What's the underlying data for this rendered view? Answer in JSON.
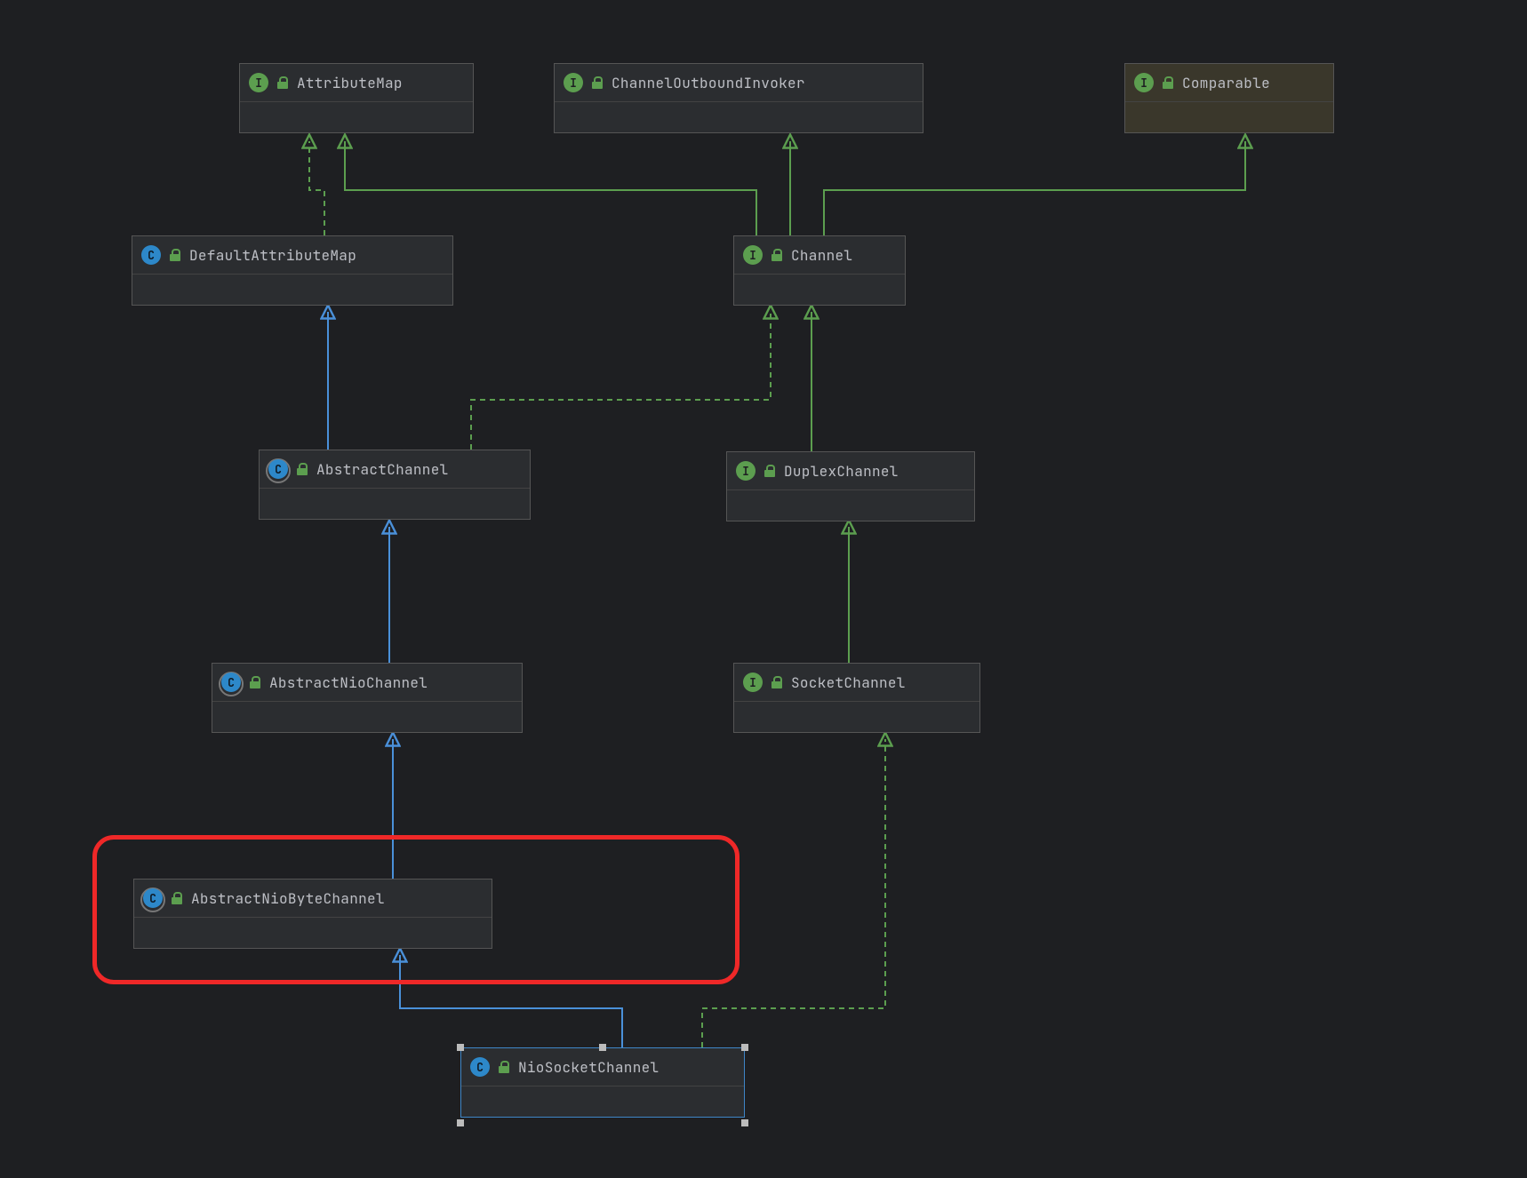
{
  "nodes": {
    "attributeMap": {
      "kind": "interface",
      "name": "AttributeMap"
    },
    "channelOutboundInvoker": {
      "kind": "interface",
      "name": "ChannelOutboundInvoker"
    },
    "comparable": {
      "kind": "interface",
      "name": "Comparable"
    },
    "defaultAttributeMap": {
      "kind": "class",
      "name": "DefaultAttributeMap"
    },
    "channel": {
      "kind": "interface",
      "name": "Channel"
    },
    "abstractChannel": {
      "kind": "abstract",
      "name": "AbstractChannel"
    },
    "duplexChannel": {
      "kind": "interface",
      "name": "DuplexChannel"
    },
    "abstractNioChannel": {
      "kind": "abstract",
      "name": "AbstractNioChannel"
    },
    "socketChannel": {
      "kind": "interface",
      "name": "SocketChannel"
    },
    "abstractNioByteChannel": {
      "kind": "abstract",
      "name": "AbstractNioByteChannel"
    },
    "nioSocketChannel": {
      "kind": "class",
      "name": "NioSocketChannel"
    }
  },
  "icon_letters": {
    "interface": "I",
    "class": "C",
    "abstract": "C"
  },
  "colors": {
    "extends": "#4a90d9",
    "implements": "#5c9e4f"
  },
  "edges": [
    {
      "from": "defaultAttributeMap",
      "to": "attributeMap",
      "type": "implements"
    },
    {
      "from": "channel",
      "to": "attributeMap",
      "type": "extends-interface"
    },
    {
      "from": "channel",
      "to": "channelOutboundInvoker",
      "type": "extends-interface"
    },
    {
      "from": "channel",
      "to": "comparable",
      "type": "extends-interface"
    },
    {
      "from": "abstractChannel",
      "to": "defaultAttributeMap",
      "type": "extends"
    },
    {
      "from": "abstractChannel",
      "to": "channel",
      "type": "implements"
    },
    {
      "from": "duplexChannel",
      "to": "channel",
      "type": "extends-interface"
    },
    {
      "from": "abstractNioChannel",
      "to": "abstractChannel",
      "type": "extends"
    },
    {
      "from": "socketChannel",
      "to": "duplexChannel",
      "type": "extends-interface"
    },
    {
      "from": "abstractNioByteChannel",
      "to": "abstractNioChannel",
      "type": "extends"
    },
    {
      "from": "nioSocketChannel",
      "to": "abstractNioByteChannel",
      "type": "extends"
    },
    {
      "from": "nioSocketChannel",
      "to": "socketChannel",
      "type": "implements"
    }
  ],
  "highlighted_node": "abstractNioByteChannel",
  "selected_node": "nioSocketChannel"
}
